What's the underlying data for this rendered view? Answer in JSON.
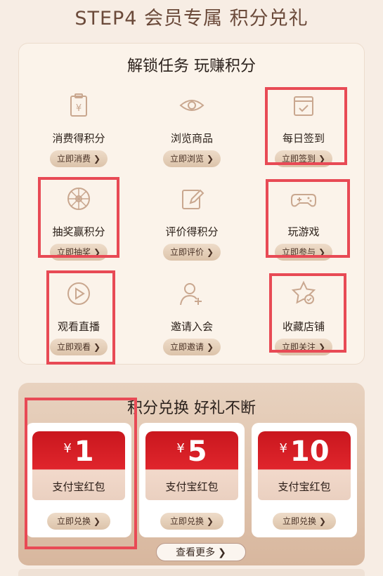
{
  "step_title": "STEP4 会员专属 积分兑礼",
  "tasks_section": {
    "title": "解锁任务 玩赚积分",
    "tasks": [
      {
        "label": "消费得积分",
        "button": "立即消费",
        "icon": "receipt-yen-icon"
      },
      {
        "label": "浏览商品",
        "button": "立即浏览",
        "icon": "eye-icon"
      },
      {
        "label": "每日签到",
        "button": "立即签到",
        "icon": "calendar-check-icon"
      },
      {
        "label": "抽奖赢积分",
        "button": "立即抽奖",
        "icon": "lottery-wheel-icon"
      },
      {
        "label": "评价得积分",
        "button": "立即评价",
        "icon": "edit-icon"
      },
      {
        "label": "玩游戏",
        "button": "立即参与",
        "icon": "gamepad-icon"
      },
      {
        "label": "观看直播",
        "button": "立即观看",
        "icon": "play-circle-icon"
      },
      {
        "label": "邀请入会",
        "button": "立即邀请",
        "icon": "user-add-icon"
      },
      {
        "label": "收藏店铺",
        "button": "立即关注",
        "icon": "star-check-icon"
      }
    ]
  },
  "exchange_section": {
    "title": "积分兑换 好礼不断",
    "currency": "¥",
    "coupons": [
      {
        "amount": "1",
        "name": "支付宝红包",
        "button": "立即兑换"
      },
      {
        "amount": "5",
        "name": "支付宝红包",
        "button": "立即兑换"
      },
      {
        "amount": "10",
        "name": "支付宝红包",
        "button": "立即兑换"
      }
    ],
    "more_button": "查看更多"
  },
  "chevron": "❯",
  "colors": {
    "highlight": "#e84a55",
    "packet_red": "#d81e26",
    "button_beige": "#e3ccb6"
  }
}
